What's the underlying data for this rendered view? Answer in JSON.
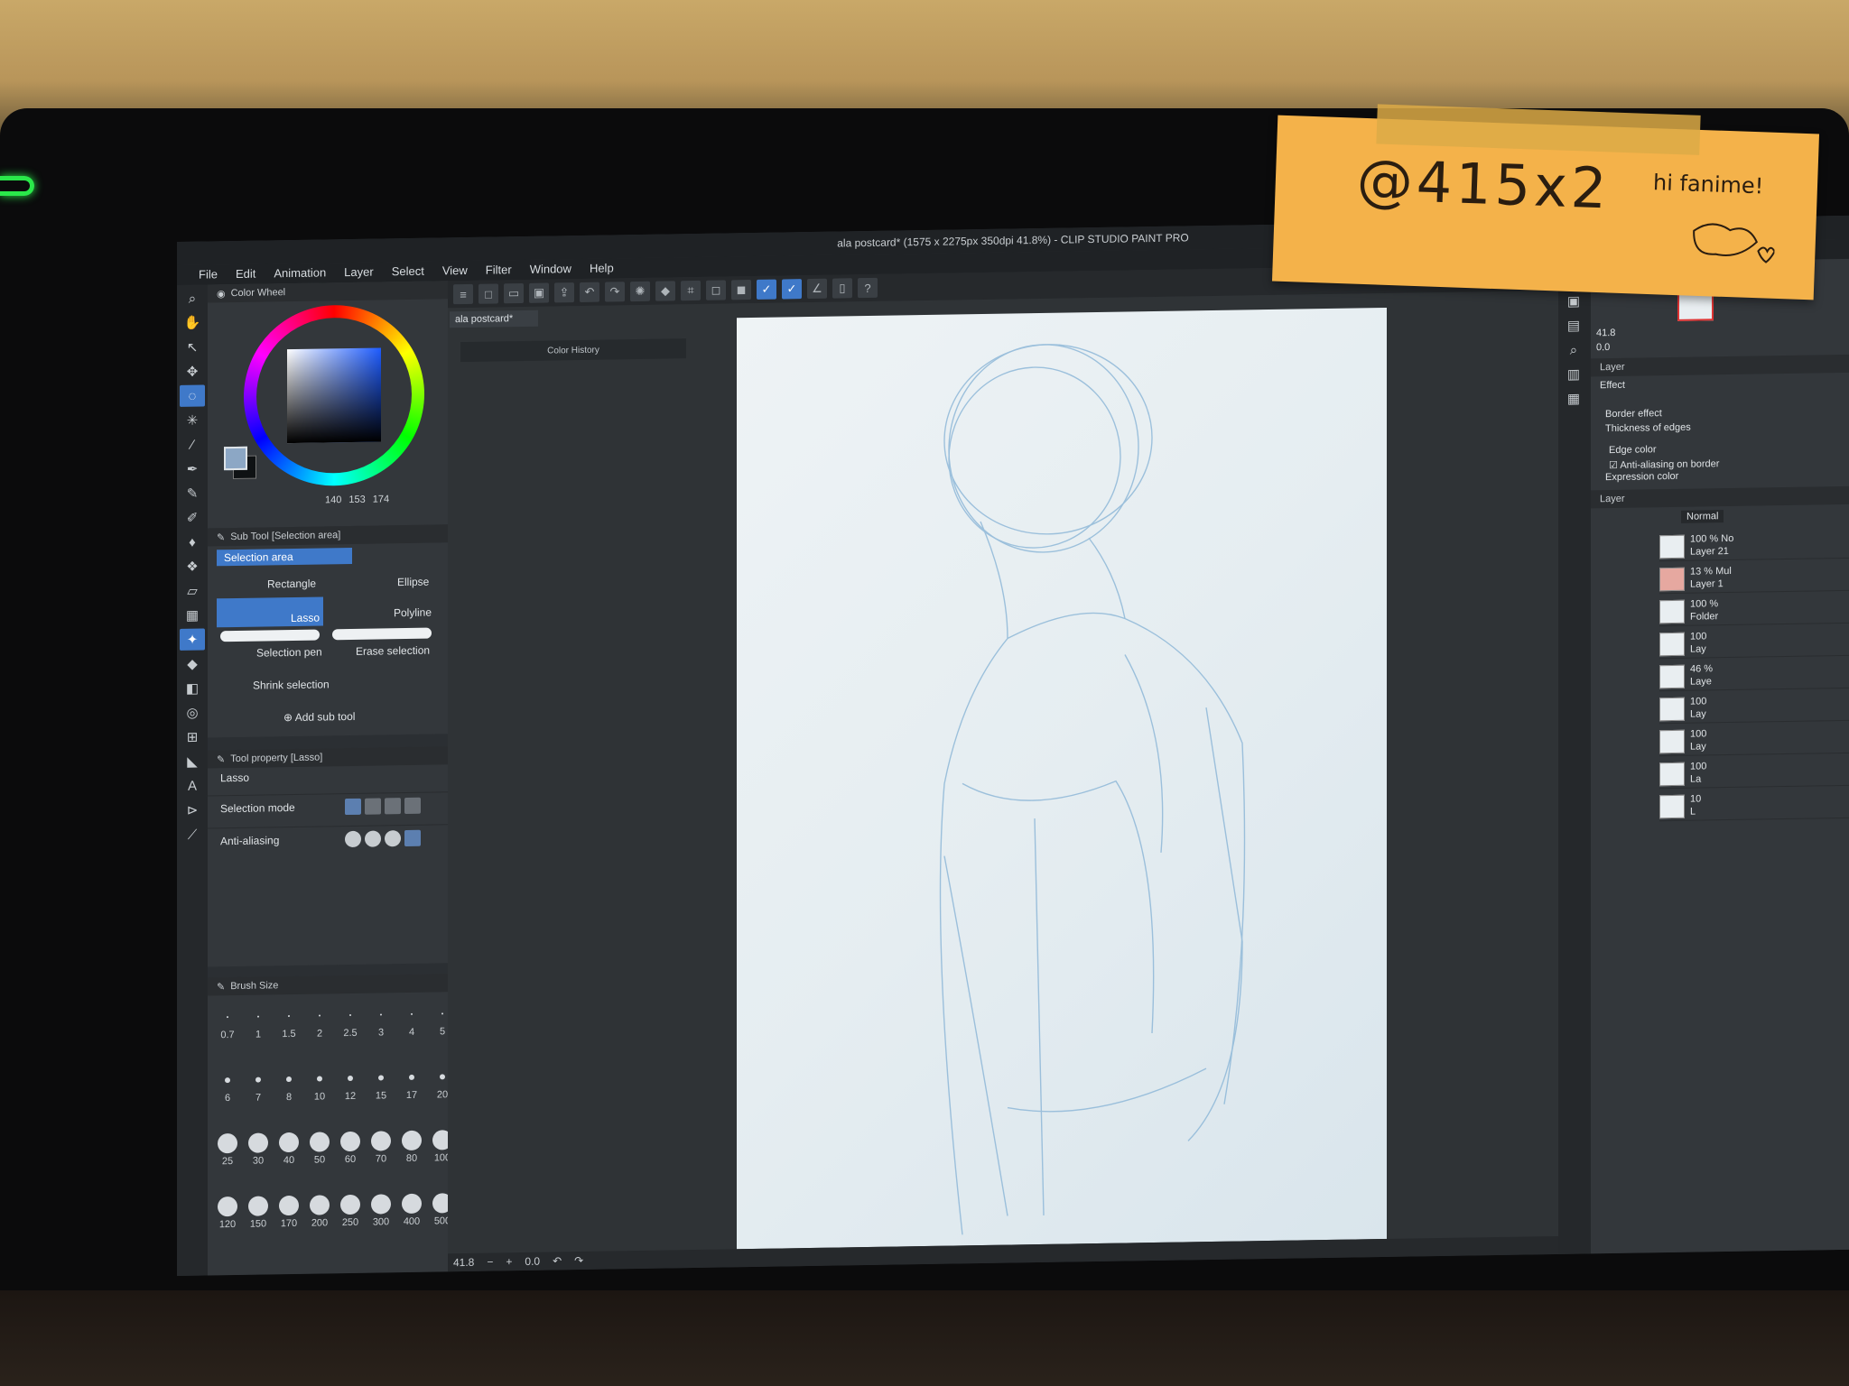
{
  "app": {
    "title": "ala postcard* (1575 x 2275px 350dpi 41.8%) - CLIP STUDIO PAINT PRO"
  },
  "menu": [
    "File",
    "Edit",
    "Animation",
    "Layer",
    "Select",
    "View",
    "Filter",
    "Window",
    "Help"
  ],
  "color_wheel": {
    "title": "Color Wheel",
    "r": "140",
    "g": "153",
    "b": "174",
    "current_color": "#8ca7c5"
  },
  "sub_tool": {
    "title": "Sub Tool [Selection area]",
    "group": "Selection area",
    "items": [
      "Rectangle",
      "Ellipse",
      "Lasso",
      "Polyline",
      "Selection pen",
      "Erase selection",
      "Shrink selection"
    ],
    "add": "Add sub tool"
  },
  "tool_property": {
    "title": "Tool property [Lasso]",
    "name": "Lasso",
    "selection_mode": "Selection mode",
    "anti_aliasing": "Anti-aliasing"
  },
  "brush_size": {
    "title": "Brush Size",
    "row1": [
      "0.7",
      "1",
      "1.5",
      "2",
      "2.5",
      "3",
      "4",
      "5"
    ],
    "row2": [
      "6",
      "7",
      "8",
      "10",
      "12",
      "15",
      "17",
      "20"
    ],
    "row3": [
      "25",
      "30",
      "40",
      "50",
      "60",
      "70",
      "80",
      "100"
    ],
    "row4": [
      "120",
      "150",
      "170",
      "200",
      "250",
      "300",
      "400",
      "500"
    ]
  },
  "canvas": {
    "doc_tab": "ala postcard*",
    "floating_panel": "Color History"
  },
  "status": {
    "zoom": "41.8",
    "rotation": "0.0"
  },
  "navigator": {
    "zoom": "41.8",
    "rotation": "0.0"
  },
  "layer_property": {
    "tab": "Layer",
    "effect": "Effect",
    "border_effect": "Border effect",
    "thickness": "Thickness of edges",
    "edge_color": "Edge color",
    "anti_aliasing_border": "Anti-aliasing on border",
    "expression_color": "Expression color"
  },
  "layers": {
    "tab": "Layer",
    "blend_mode": "Normal",
    "rows": [
      {
        "pct": "100 % No",
        "name": "Layer 21"
      },
      {
        "pct": "13 % Mul",
        "name": "Layer 1"
      },
      {
        "pct": "100 %",
        "name": "Folder"
      },
      {
        "pct": "100",
        "name": "Lay"
      },
      {
        "pct": "46 %",
        "name": "Laye"
      },
      {
        "pct": "100",
        "name": "Lay"
      },
      {
        "pct": "100",
        "name": "Lay"
      },
      {
        "pct": "100",
        "name": "La"
      },
      {
        "pct": "10",
        "name": "L"
      }
    ]
  },
  "sticky_note": {
    "handle": "@415x2",
    "greeting": "hi fanime!"
  }
}
